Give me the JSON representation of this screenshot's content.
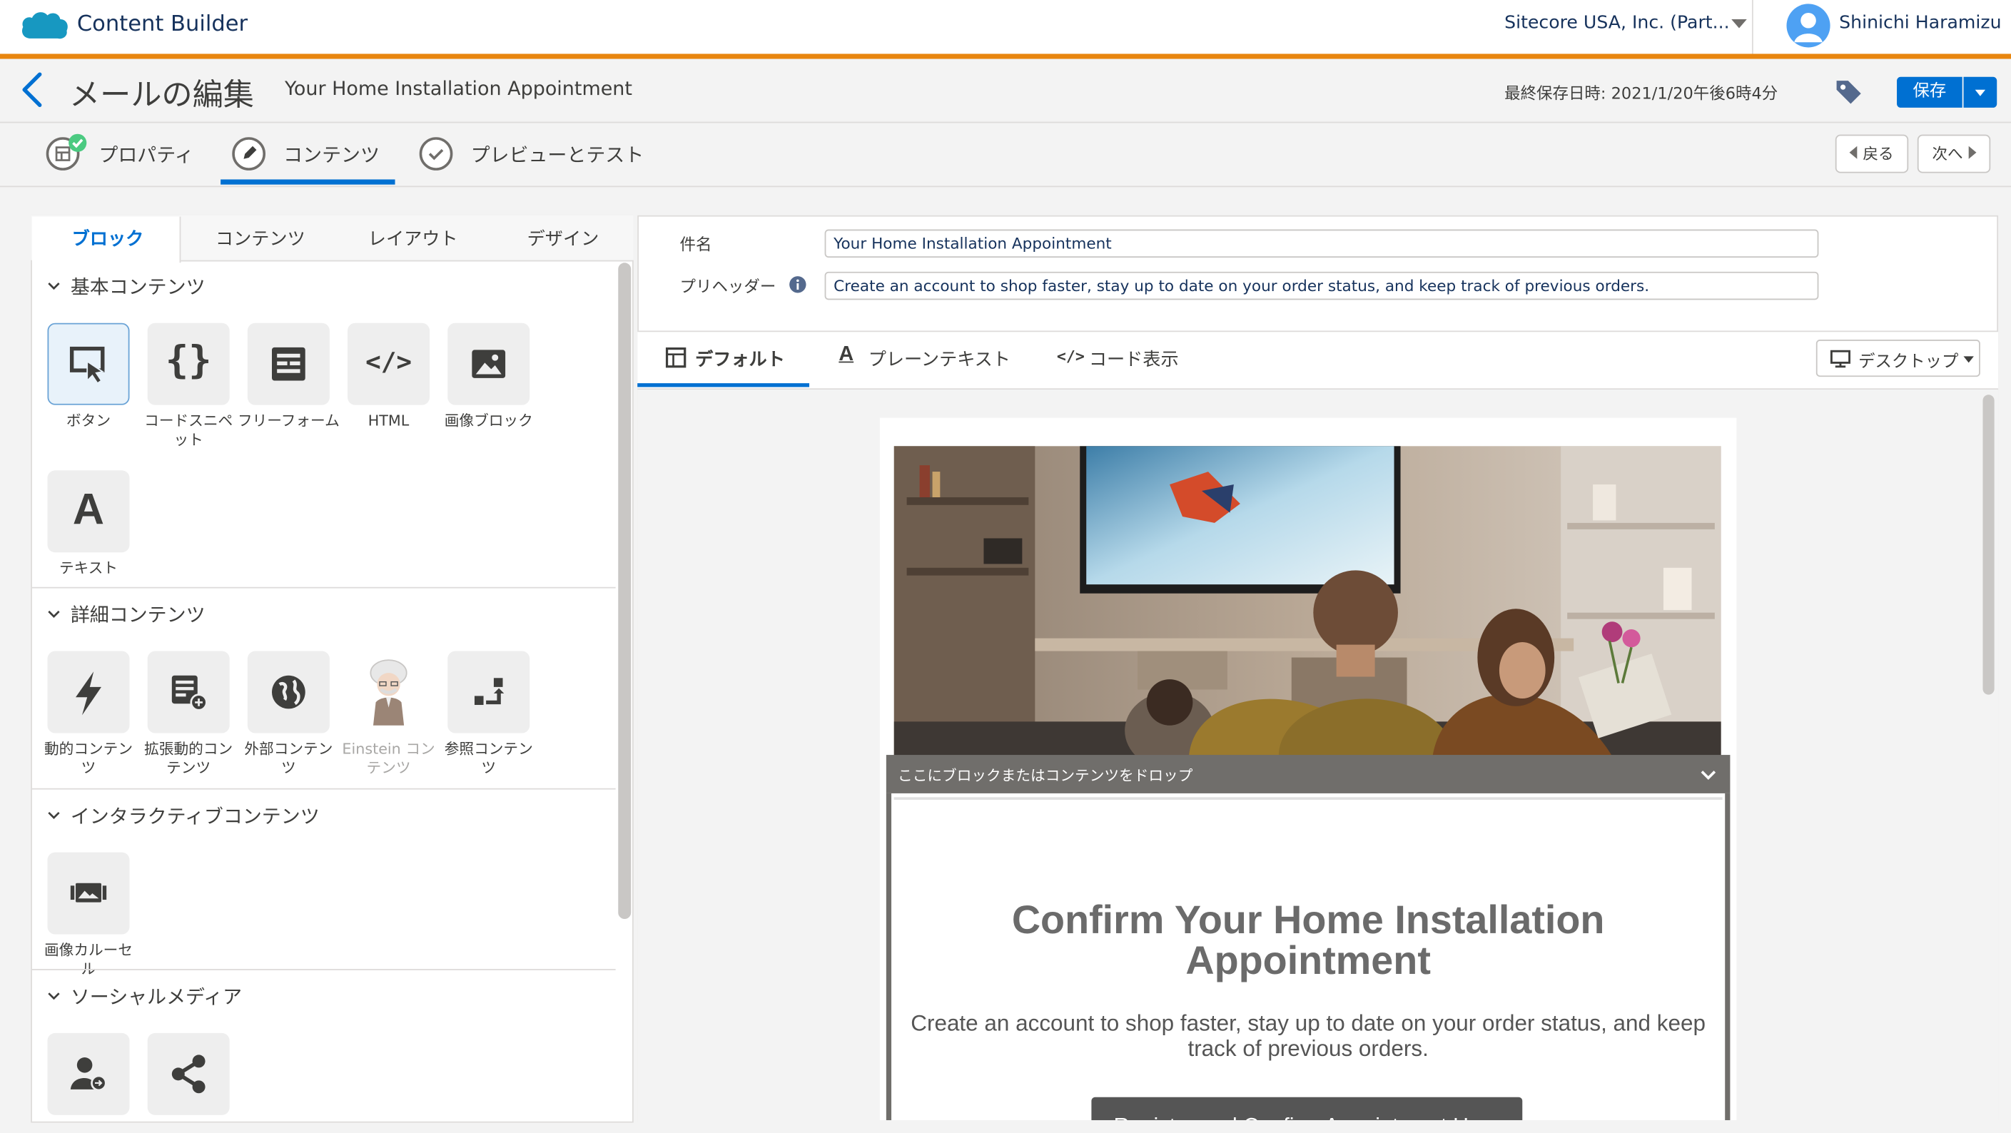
{
  "topbar": {
    "app_name": "Content Builder",
    "org_name": "Sitecore USA, Inc. (Part...",
    "user_name": "Shinichi Haramizu"
  },
  "editor": {
    "page_title": "メールの編集",
    "email_name": "Your Home Installation Appointment",
    "last_saved": "最終保存日時: 2021/1/20午後6時4分",
    "save_label": "保存"
  },
  "steps": [
    {
      "label": "プロパティ"
    },
    {
      "label": "コンテンツ"
    },
    {
      "label": "プレビューとテスト"
    }
  ],
  "step_nav": {
    "back_label": "戻る",
    "next_label": "次へ"
  },
  "left_tabs": [
    "ブロック",
    "コンテンツ",
    "レイアウト",
    "デザイン"
  ],
  "sections": {
    "basic": {
      "title": "基本コンテンツ",
      "tiles": [
        {
          "label": "ボタン",
          "icon": "button-icon"
        },
        {
          "label": "コードスニペット",
          "icon": "code-braces-icon"
        },
        {
          "label": "フリーフォーム",
          "icon": "freeform-icon"
        },
        {
          "label": "HTML",
          "icon": "html-icon"
        },
        {
          "label": "画像ブロック",
          "icon": "image-icon"
        },
        {
          "label": "テキスト",
          "icon": "text-icon"
        }
      ]
    },
    "detail": {
      "title": "詳細コンテンツ",
      "tiles": [
        {
          "label": "動的コンテンツ",
          "icon": "lightning-icon"
        },
        {
          "label": "拡張動的コンテンツ",
          "icon": "enhanced-dynamic-icon"
        },
        {
          "label": "外部コンテンツ",
          "icon": "globe-icon"
        },
        {
          "label": "Einstein コンテンツ",
          "icon": "einstein-icon"
        },
        {
          "label": "参照コンテンツ",
          "icon": "reference-icon"
        }
      ]
    },
    "interactive": {
      "title": "インタラクティブコンテンツ",
      "tiles": [
        {
          "label": "画像カルーセル",
          "icon": "carousel-icon"
        }
      ]
    },
    "social": {
      "title": "ソーシャルメディア",
      "tiles": [
        {
          "label": "",
          "icon": "social-follow-icon"
        },
        {
          "label": "",
          "icon": "share-icon"
        }
      ]
    }
  },
  "fields": {
    "subject_label": "件名",
    "subject_value": "Your Home Installation Appointment",
    "preheader_label": "プリヘッダー",
    "preheader_value": "Create an account to shop faster, stay up to date on your order status, and keep track of previous orders."
  },
  "view_tabs": [
    "デフォルト",
    "プレーンテキスト",
    "コード表示"
  ],
  "device_select": "デスクトップ",
  "email_preview": {
    "drop_hint": "ここにブロックまたはコンテンツをドロップ",
    "headline": "Confirm Your Home Installation Appointment",
    "body": "Create an account to shop faster, stay up to date on your order status, and keep track of previous orders.",
    "cta": "Register and Confirm Appointment Here"
  },
  "colors": {
    "accent": "#0070d2",
    "orange_bar": "#e8860f",
    "success": "#4bca81"
  }
}
